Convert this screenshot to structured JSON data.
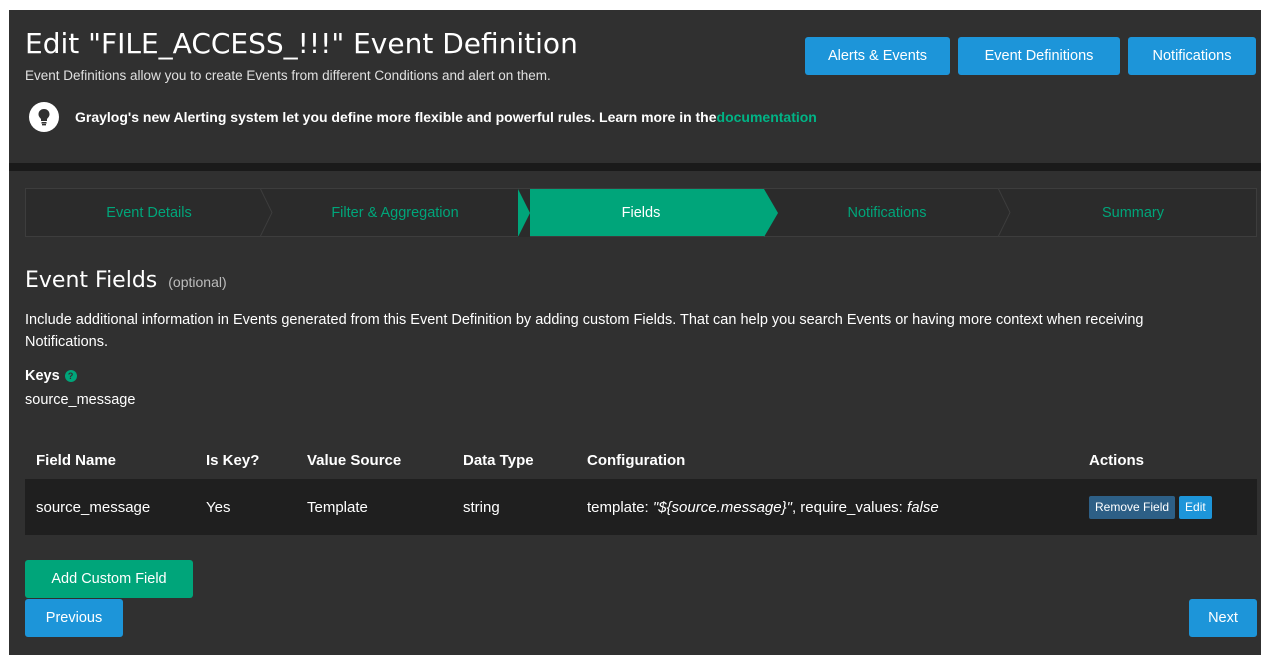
{
  "header": {
    "title": "Edit \"FILE_ACCESS_!!!\" Event Definition",
    "subtitle": "Event Definitions allow you to create Events from different Conditions and alert on them.",
    "buttons": [
      "Alerts & Events",
      "Event Definitions",
      "Notifications"
    ],
    "hint_text": "Graylog's new Alerting system let you define more flexible and powerful rules. Learn more in the ",
    "hint_link": "documentation",
    "hint_icon": "lightbulb-icon"
  },
  "wizard": {
    "steps": [
      "Event Details",
      "Filter & Aggregation",
      "Fields",
      "Notifications",
      "Summary"
    ],
    "active_step": "Fields"
  },
  "section": {
    "title": "Event Fields",
    "optional": "(optional)",
    "description": "Include additional information in Events generated from this Event Definition by adding custom Fields. That can help you search Events or having more context when receiving Notifications.",
    "keys_label": "Keys",
    "keys_value": "source_message"
  },
  "table": {
    "headers": [
      "Field Name",
      "Is Key?",
      "Value Source",
      "Data Type",
      "Configuration",
      "Actions"
    ],
    "rows": [
      {
        "field_name": "source_message",
        "is_key": "Yes",
        "value_source": "Template",
        "data_type": "string",
        "config_prefix": "template: ",
        "config_template": "\"${source.message}\"",
        "config_mid": ", require_values: ",
        "config_require": "false",
        "remove_label": "Remove Field",
        "edit_label": "Edit"
      }
    ]
  },
  "footer": {
    "add_label": "Add Custom Field",
    "prev_label": "Previous",
    "next_label": "Next"
  },
  "colors": {
    "background": "#303030",
    "primary": "#1d95d9",
    "accent": "#00a57a",
    "row_background": "#1f1f1f"
  }
}
